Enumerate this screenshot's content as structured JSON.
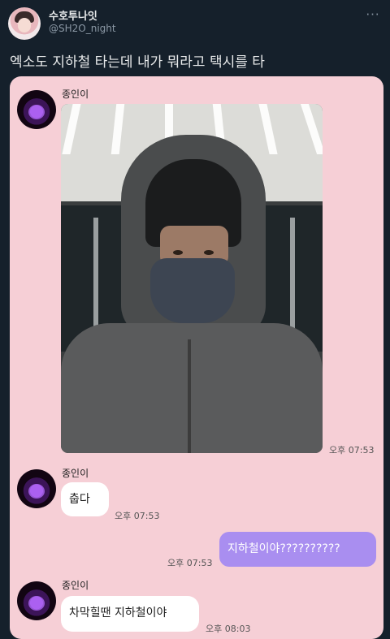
{
  "tweet": {
    "username": "수호투나잇",
    "handle": "@SH2O_night",
    "more_icon": "more-icon",
    "text": "엑소도 지하철 타는데 내가 뭐라고 택시를 타"
  },
  "chat": {
    "messages": [
      {
        "sender": "종인이",
        "type": "photo",
        "time": "오후 07:53"
      },
      {
        "sender": "종인이",
        "type": "text",
        "text": "춥다",
        "time": "오후 07:53"
      },
      {
        "sender": "me",
        "type": "text",
        "text": "지하철이야??????????",
        "time": "오후 07:53"
      },
      {
        "sender": "종인이",
        "type": "text",
        "text": "차막힐땐 지하철이야",
        "time": "오후 08:03"
      }
    ],
    "colors": {
      "background": "#f6cfd6",
      "my_bubble": "#a98ef0",
      "their_bubble": "#ffffff"
    }
  }
}
